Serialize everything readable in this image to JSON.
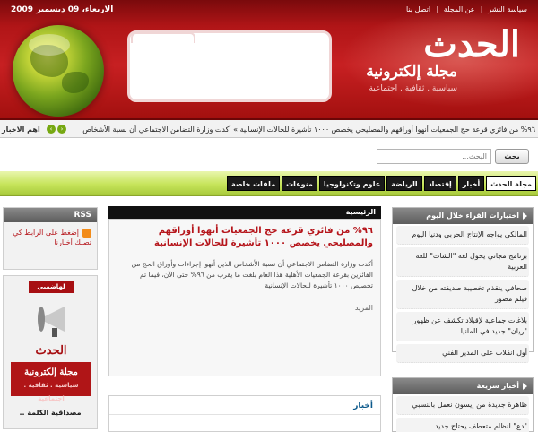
{
  "header": {
    "date": "الاربعاء، 09 ديسمبر 2009",
    "top_links": [
      "سياسة النشر",
      "عن المجلة",
      "اتصل بنا"
    ],
    "logo_mark": "الحدث",
    "logo_title": "مجلة إلكترونية",
    "logo_subtitle": "سياسية . ثقافية . اجتماعية"
  },
  "ticker": {
    "label": "اهم الاخبار",
    "text": "٩٦% من فائزي قرعة حج الجمعيات أنهوا أوراقهم والمصليحي يخصص ١٠٠٠ تأشيرة للحالات الإنسانية  » أكدت وزارة التضامن الاجتماعي أن نسبة الأشخاص",
    "prev_label": "‹",
    "next_label": "›"
  },
  "search": {
    "button_label": "بحث",
    "placeholder": "البحث..."
  },
  "nav": {
    "items": [
      "مجلة الحدث",
      "أخبار",
      "إقتصاد",
      "الرياضة",
      "علوم وتكنولوجيا",
      "منوعات",
      "ملفات خاصة"
    ]
  },
  "main": {
    "section_title": "الرئيسية",
    "headline": "٩٦% من فائزي قرعة حج الجمعيات أنهوا أوراقهم والمصليحي يخصص ١٠٠٠ تأشيرة للحالات الإنسانية",
    "paragraph": "أكدت وزارة التضامن الاجتماعي أن نسبة الأشخاص الذين أنهوا إجراءات وأوراق الحج من الفائزين بقرعة الجمعيات الأهلية هذا العام بلغت ما يقرب من ٩٦% حتى الآن، فيما تم تخصيص ١٠٠٠ تأشيرة للحالات الإنسانية",
    "more_label": "المزيد",
    "news_title": "أخبار"
  },
  "right_column": {
    "most_read_title": "اختيارات القراء خلال اليوم",
    "most_read": [
      "المالكي يواجه الإنتاج الحربي ودنيا اليوم",
      "برنامج مجاني يحول لغة \"الشات\" للغة العربية",
      "صحافي ينقذم تخطيبة صديقته من خلال فيلم مصور",
      "بلاغات جماعية لإقبلاد تكشف عن ظهور \"ريان\" جديد في المانيا",
      "أول انقلاب على المدير الفني"
    ],
    "quick_news_title": "أخبار سريعة",
    "quick_news": [
      "ظاهرة جديدة من إيسون نعمل بالنسبي",
      "\"دع\" لنظام متعطف يحتاج جديد"
    ]
  },
  "left_column": {
    "rss_title": "RSS",
    "rss_text": "إضغط على الرابط كي تصلك أخبارنا",
    "ad_tab": "لهاضميي",
    "ad_logo": "الحدث",
    "ad_red_title": "مجلة إلكترونية",
    "ad_red_sub": "سياسية . ثقافية . اجتماعية",
    "ad_caption": "مصداقية الكلمة .."
  }
}
